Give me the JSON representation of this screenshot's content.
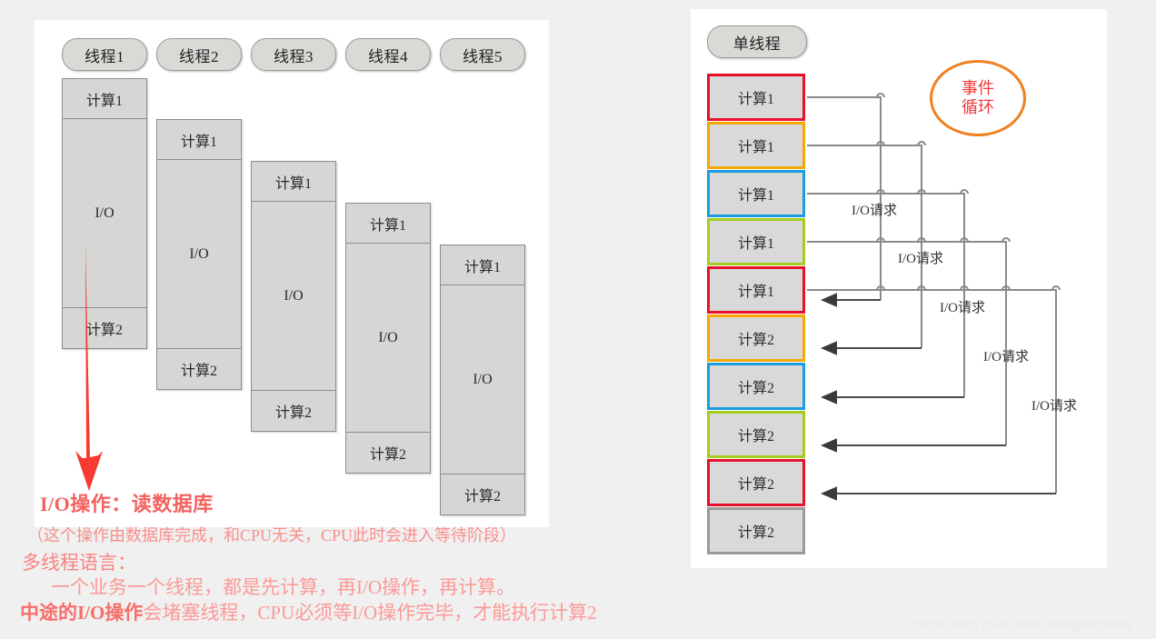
{
  "left_panel": {
    "title_pills": [
      {
        "label": "线程1"
      },
      {
        "label": "线程2"
      },
      {
        "label": "线程3"
      },
      {
        "label": "线程4"
      },
      {
        "label": "线程5"
      }
    ],
    "columns": [
      {
        "calc1": "计算1",
        "io": "I/O",
        "calc2": "计算2"
      },
      {
        "calc1": "计算1",
        "io": "I/O",
        "calc2": "计算2"
      },
      {
        "calc1": "计算1",
        "io": "I/O",
        "calc2": "计算2"
      },
      {
        "calc1": "计算1",
        "io": "I/O",
        "calc2": "计算2"
      },
      {
        "calc1": "计算1",
        "io": "I/O",
        "calc2": "计算2"
      }
    ],
    "arrow_color": "#f93a33"
  },
  "notes": {
    "line1": "I/O操作：读数据库",
    "line2": "（这个操作由数据库完成，和CPU无关，CPU此时会进入等待阶段）",
    "line3": "多线程语言：",
    "line4": "一个业务一个线程，都是先计算，再I/O操作，再计算。",
    "line5_bold": "中途的I/O操作",
    "line5_rest": "会堵塞线程，CPU必须等I/O操作完毕，才能执行计算2"
  },
  "right_panel": {
    "title_pill": "单线程",
    "event_loop": {
      "line1": "事件",
      "line2": "循环",
      "border_color": "#f08020",
      "text_color": "#ef3b3b"
    },
    "blocks": [
      {
        "label": "计算1",
        "border_color": "#e8112d"
      },
      {
        "label": "计算1",
        "border_color": "#f5a800"
      },
      {
        "label": "计算1",
        "border_color": "#1b9ce0"
      },
      {
        "label": "计算1",
        "border_color": "#a5cd1e"
      },
      {
        "label": "计算1",
        "border_color": "#e8112d"
      },
      {
        "label": "计算2",
        "border_color": "#f5a800"
      },
      {
        "label": "计算2",
        "border_color": "#1b9ce0"
      },
      {
        "label": "计算2",
        "border_color": "#a5cd1e"
      },
      {
        "label": "计算2",
        "border_color": "#e8112d"
      },
      {
        "label": "计算2",
        "border_color": "#9a9a9a"
      }
    ],
    "wire_labels": [
      {
        "text": "I/O请求"
      },
      {
        "text": "I/O请求"
      },
      {
        "text": "I/O请求"
      },
      {
        "text": "I/O请求"
      },
      {
        "text": "I/O请求"
      }
    ]
  },
  "watermark": "https://blog.csdn.net/CodingmanNAN"
}
